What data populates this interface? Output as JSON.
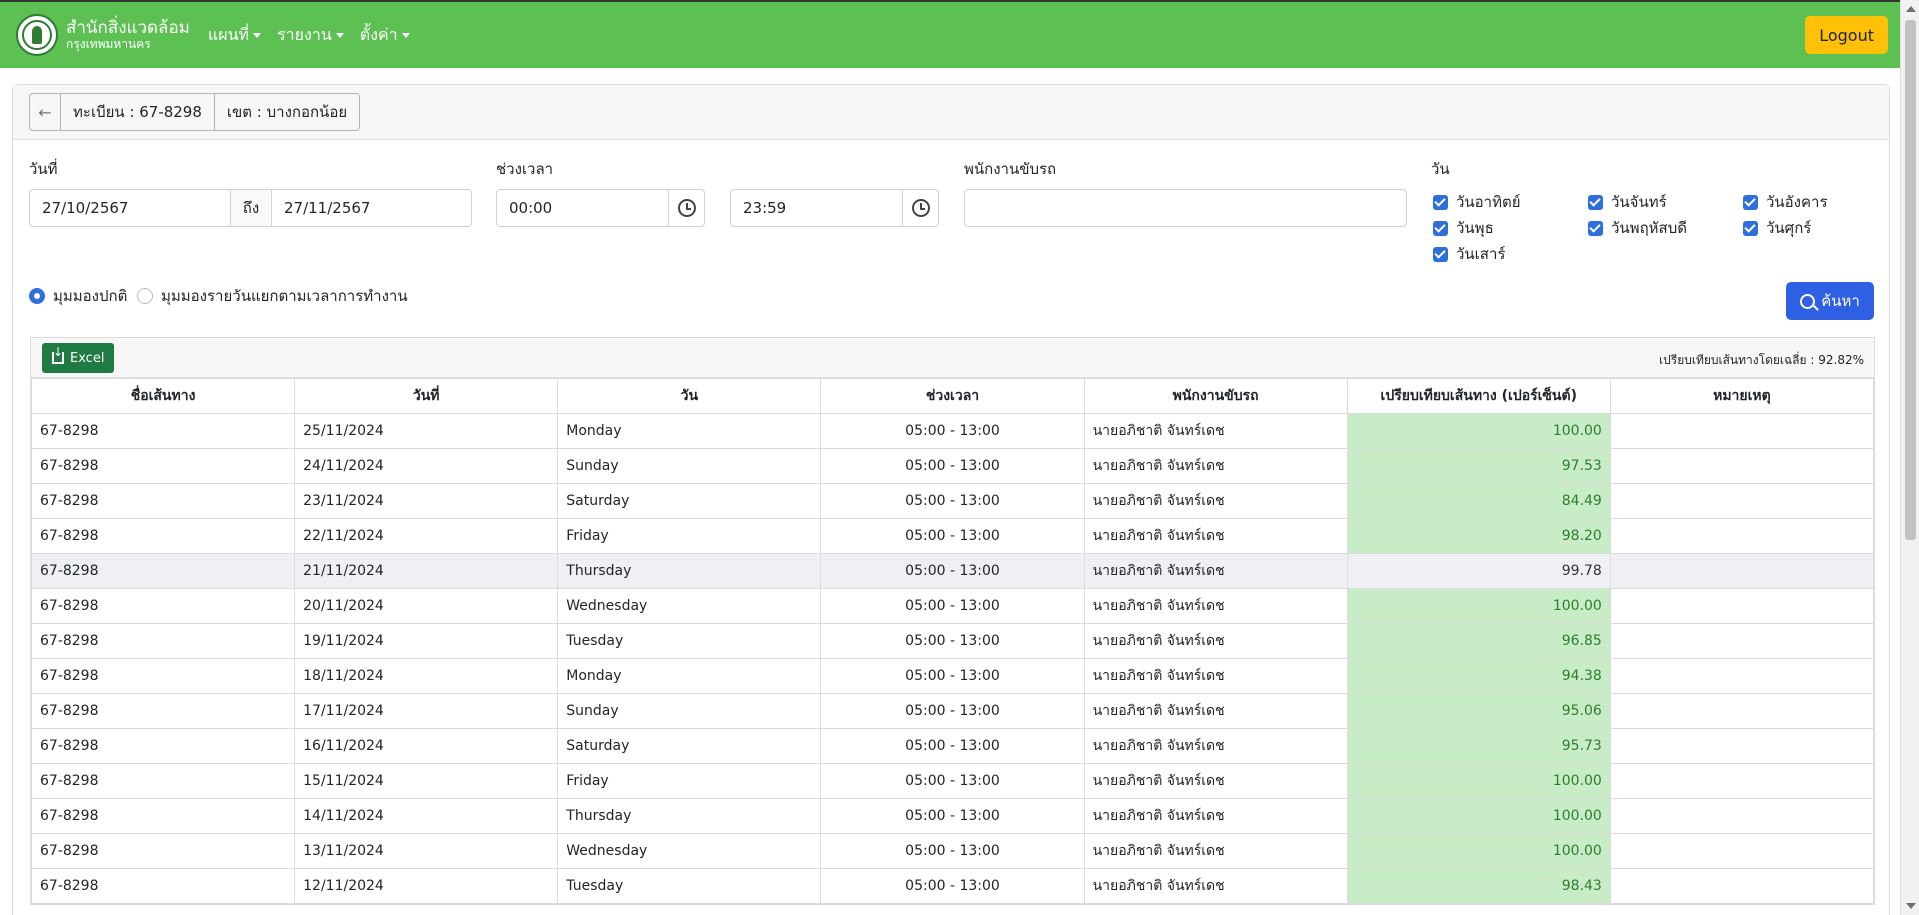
{
  "nav": {
    "brand_title": "สำนักสิ่งแวดล้อม",
    "brand_sub": "กรุงเทพมหานคร",
    "menu": [
      {
        "label": "แผนที่"
      },
      {
        "label": "รายงาน"
      },
      {
        "label": "ตั้งค่า"
      }
    ],
    "logout_label": "Logout"
  },
  "header": {
    "back_icon": "←",
    "plate": "ทะเบียน : 67-8298",
    "district": "เขต : บางกอกน้อย"
  },
  "filters": {
    "date_label": "วันที่",
    "date_from": "27/10/2567",
    "to_label": "ถึง",
    "date_to": "27/11/2567",
    "time_label": "ช่วงเวลา",
    "time_from": "00:00",
    "time_to": "23:59",
    "driver_label": "พนักงานขับรถ",
    "driver_value": "",
    "day_label": "วัน",
    "days": [
      "วันอาทิตย์",
      "วันจันทร์",
      "วันอังคาร",
      "วันพุธ",
      "วันพฤหัสบดี",
      "วันศุกร์",
      "วันเสาร์"
    ],
    "view_normal": "มุมมองปกติ",
    "view_daily": "มุมมองรายวันแยกตามเวลาการทำงาน",
    "search_label": "ค้นหา"
  },
  "table": {
    "excel_label": "Excel",
    "avg_note": "เปรียบเทียบเส้นทางโดยเฉลี่ย : 92.82%",
    "columns": [
      "ชื่อเส้นทาง",
      "วันที่",
      "วัน",
      "ช่วงเวลา",
      "พนักงานขับรถ",
      "เปรียบเทียบเส้นทาง (เปอร์เซ็นต์)",
      "หมายเหตุ"
    ],
    "rows": [
      {
        "route": "67-8298",
        "date": "25/11/2024",
        "day": "Monday",
        "time": "05:00 - 13:00",
        "driver": "นายอภิชาติ จันทร์เดช",
        "pct": "100.00",
        "note": ""
      },
      {
        "route": "67-8298",
        "date": "24/11/2024",
        "day": "Sunday",
        "time": "05:00 - 13:00",
        "driver": "นายอภิชาติ จันทร์เดช",
        "pct": "97.53",
        "note": ""
      },
      {
        "route": "67-8298",
        "date": "23/11/2024",
        "day": "Saturday",
        "time": "05:00 - 13:00",
        "driver": "นายอภิชาติ จันทร์เดช",
        "pct": "84.49",
        "note": ""
      },
      {
        "route": "67-8298",
        "date": "22/11/2024",
        "day": "Friday",
        "time": "05:00 - 13:00",
        "driver": "นายอภิชาติ จันทร์เดช",
        "pct": "98.20",
        "note": ""
      },
      {
        "route": "67-8298",
        "date": "21/11/2024",
        "day": "Thursday",
        "time": "05:00 - 13:00",
        "driver": "นายอภิชาติ จันทร์เดช",
        "pct": "99.78",
        "note": ""
      },
      {
        "route": "67-8298",
        "date": "20/11/2024",
        "day": "Wednesday",
        "time": "05:00 - 13:00",
        "driver": "นายอภิชาติ จันทร์เดช",
        "pct": "100.00",
        "note": ""
      },
      {
        "route": "67-8298",
        "date": "19/11/2024",
        "day": "Tuesday",
        "time": "05:00 - 13:00",
        "driver": "นายอภิชาติ จันทร์เดช",
        "pct": "96.85",
        "note": ""
      },
      {
        "route": "67-8298",
        "date": "18/11/2024",
        "day": "Monday",
        "time": "05:00 - 13:00",
        "driver": "นายอภิชาติ จันทร์เดช",
        "pct": "94.38",
        "note": ""
      },
      {
        "route": "67-8298",
        "date": "17/11/2024",
        "day": "Sunday",
        "time": "05:00 - 13:00",
        "driver": "นายอภิชาติ จันทร์เดช",
        "pct": "95.06",
        "note": ""
      },
      {
        "route": "67-8298",
        "date": "16/11/2024",
        "day": "Saturday",
        "time": "05:00 - 13:00",
        "driver": "นายอภิชาติ จันทร์เดช",
        "pct": "95.73",
        "note": ""
      },
      {
        "route": "67-8298",
        "date": "15/11/2024",
        "day": "Friday",
        "time": "05:00 - 13:00",
        "driver": "นายอภิชาติ จันทร์เดช",
        "pct": "100.00",
        "note": ""
      },
      {
        "route": "67-8298",
        "date": "14/11/2024",
        "day": "Thursday",
        "time": "05:00 - 13:00",
        "driver": "นายอภิชาติ จันทร์เดช",
        "pct": "100.00",
        "note": ""
      },
      {
        "route": "67-8298",
        "date": "13/11/2024",
        "day": "Wednesday",
        "time": "05:00 - 13:00",
        "driver": "นายอภิชาติ จันทร์เดช",
        "pct": "100.00",
        "note": ""
      },
      {
        "route": "67-8298",
        "date": "12/11/2024",
        "day": "Tuesday",
        "time": "05:00 - 13:00",
        "driver": "นายอภิชาติ จันทร์เดช",
        "pct": "98.43",
        "note": ""
      }
    ]
  }
}
